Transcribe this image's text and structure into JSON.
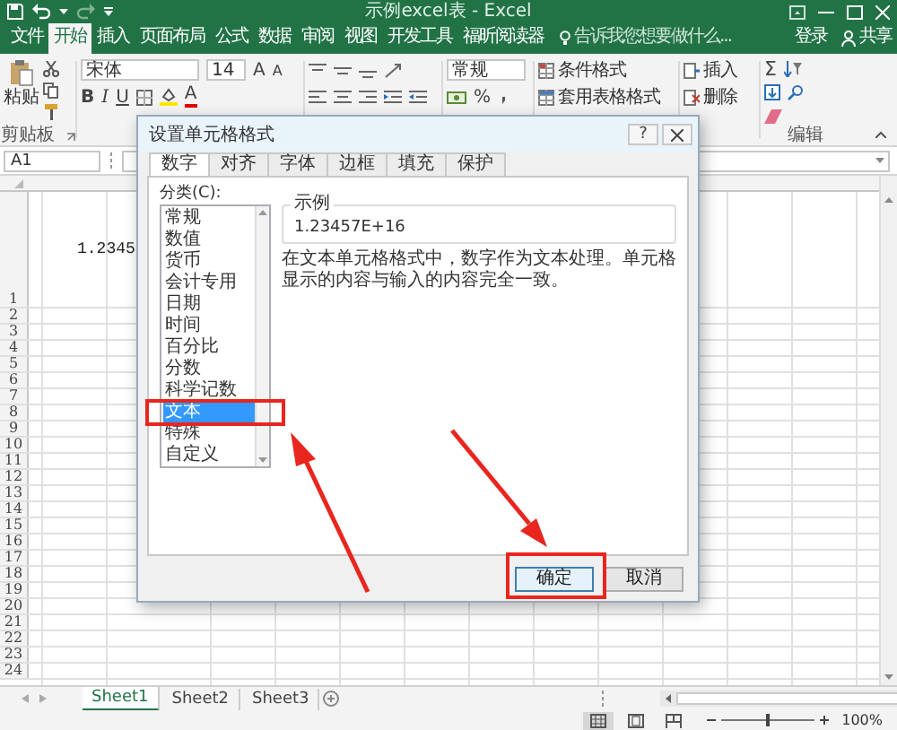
{
  "title_bar": {
    "title": "示例excel表 - Excel"
  },
  "ribbon_tabs": [
    {
      "label": "文件",
      "selected": false
    },
    {
      "label": "开始",
      "selected": true
    },
    {
      "label": "插入",
      "selected": false
    },
    {
      "label": "页面布局",
      "selected": false
    },
    {
      "label": "公式",
      "selected": false
    },
    {
      "label": "数据",
      "selected": false
    },
    {
      "label": "审阅",
      "selected": false
    },
    {
      "label": "视图",
      "selected": false
    },
    {
      "label": "开发工具",
      "selected": false
    },
    {
      "label": "福昕阅读器",
      "selected": false
    }
  ],
  "tell_me": {
    "placeholder": "告诉我您想要做什么..."
  },
  "account": {
    "sign_in": "登录",
    "share": "共享"
  },
  "ribbon": {
    "paste": "粘贴",
    "clipboard_label": "剪贴板",
    "font_name": "宋体",
    "font_size": "14",
    "grow_font": "A",
    "shrink_font": "A",
    "font_styles": [
      "B",
      "I",
      "U"
    ],
    "font_color": "A",
    "number_format": "常规",
    "percent": "%",
    "styles": [
      "条件格式",
      "套用表格格式"
    ],
    "cells": [
      "插入",
      "删除"
    ],
    "autosum": "Σ",
    "editing_label": "编辑"
  },
  "formula_bar": {
    "name_box": "A1"
  },
  "sheet": {
    "cell_value": "1.2345",
    "row_headers": [
      "1",
      "2",
      "3",
      "4",
      "5",
      "6",
      "7",
      "8",
      "9",
      "10",
      "11",
      "12",
      "13",
      "14",
      "15",
      "16",
      "17",
      "18",
      "19",
      "20",
      "21",
      "22",
      "23",
      "24"
    ]
  },
  "dialog": {
    "title": "设置单元格格式",
    "help": "?",
    "tabs": [
      {
        "label": "数字",
        "selected": true
      },
      {
        "label": "对齐",
        "selected": false
      },
      {
        "label": "字体",
        "selected": false
      },
      {
        "label": "边框",
        "selected": false
      },
      {
        "label": "填充",
        "selected": false
      },
      {
        "label": "保护",
        "selected": false
      }
    ],
    "category_label": "分类(C):",
    "categories": [
      {
        "label": "常规",
        "selected": false
      },
      {
        "label": "数值",
        "selected": false
      },
      {
        "label": "货币",
        "selected": false
      },
      {
        "label": "会计专用",
        "selected": false
      },
      {
        "label": "日期",
        "selected": false
      },
      {
        "label": "时间",
        "selected": false
      },
      {
        "label": "百分比",
        "selected": false
      },
      {
        "label": "分数",
        "selected": false
      },
      {
        "label": "科学记数",
        "selected": false
      },
      {
        "label": "文本",
        "selected": true
      },
      {
        "label": "特殊",
        "selected": false
      },
      {
        "label": "自定义",
        "selected": false
      }
    ],
    "sample_label": "示例",
    "sample_value": "1.23457E+16",
    "description": "在文本单元格格式中，数字作为文本处理。单元格显示的内容与输入的内容完全一致。",
    "buttons": [
      {
        "label": "确定",
        "kind": "default"
      },
      {
        "label": "取消",
        "kind": "normal"
      }
    ]
  },
  "sheet_tabs": [
    {
      "label": "Sheet1",
      "selected": true
    },
    {
      "label": "Sheet2",
      "selected": false
    },
    {
      "label": "Sheet3",
      "selected": false
    }
  ],
  "status_bar": {
    "zoom": "100%",
    "zoom_slider": {
      "level": 0.5
    },
    "views": [
      {
        "kind": "normal",
        "selected": true
      },
      {
        "kind": "layout",
        "selected": false
      },
      {
        "kind": "break",
        "selected": false
      }
    ]
  }
}
